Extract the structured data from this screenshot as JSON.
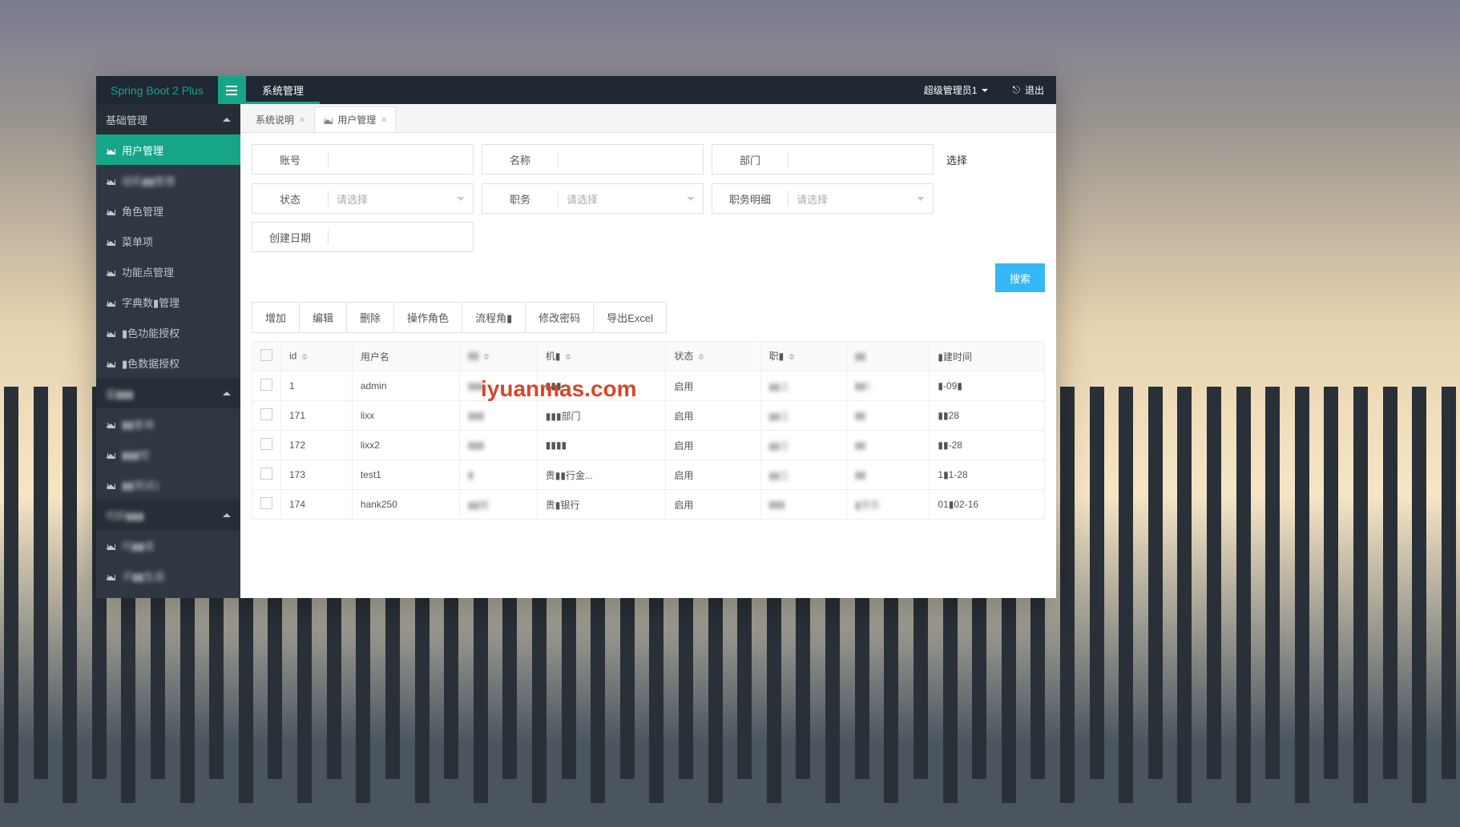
{
  "brand": "Spring Boot 2 Plus",
  "top_nav": {
    "system_mgmt": "系统管理"
  },
  "user": {
    "name": "超级管理员1",
    "logout": "退出"
  },
  "sidebar": {
    "groups": [
      {
        "label": "基础管理"
      },
      {
        "label": "监▮▮▮"
      },
      {
        "label": "代码▮▮▮"
      }
    ],
    "items": [
      "用户管理",
      "组机▮▮管理",
      "角色管理",
      "菜单项",
      "功能点管理",
      "字典数▮管理",
      "▮色功能授权",
      "▮色数据授权",
      "▮▮查询",
      "▮▮▮控",
      "▮▮测试1",
      "代▮▮成",
      "子▮▮生成"
    ]
  },
  "tabs": {
    "system_desc": "系统说明",
    "user_mgmt": "用户管理"
  },
  "filters": {
    "account": "账号",
    "name": "名称",
    "dept": "部门",
    "choose": "选择",
    "status": "状态",
    "position": "职务",
    "position_detail": "职务明细",
    "create_date": "创建日期",
    "placeholder_select": "请选择"
  },
  "buttons": {
    "search": "搜索",
    "add": "增加",
    "edit": "编辑",
    "delete": "删除",
    "op_role": "操作角色",
    "process": "流程角▮",
    "change_pwd": "修改密码",
    "export": "导出Excel"
  },
  "table": {
    "headers": {
      "id": "id",
      "username": "用户名",
      "col3": "▮▮",
      "org": "机▮",
      "status": "状态",
      "pos": "职▮",
      "col7": "▮▮",
      "create_time": "▮建时间"
    },
    "rows": [
      {
        "id": "1",
        "username": "admin",
        "c3": "▮▮▮",
        "org": "▮▮▮",
        "status": "启用",
        "pos": "▮▮立",
        "c7": "▮▮1",
        "time": "▮-09▮"
      },
      {
        "id": "171",
        "username": "lixx",
        "c3": "▮▮▮",
        "org": "▮▮▮部门",
        "status": "启用",
        "pos": "▮▮立",
        "c7": "▮▮",
        "time": "▮▮28"
      },
      {
        "id": "172",
        "username": "lixx2",
        "c3": "▮▮▮",
        "org": "▮▮▮▮",
        "status": "启用",
        "pos": "▮▮立",
        "c7": "▮▮",
        "time": "▮▮-28"
      },
      {
        "id": "173",
        "username": "test1",
        "c3": "▮",
        "org": "贵▮▮行金...",
        "status": "启用",
        "pos": "▮▮立",
        "c7": "▮▮",
        "time": "1▮1-28"
      },
      {
        "id": "174",
        "username": "hank250",
        "c3": "▮▮辑",
        "org": "贵▮银行",
        "status": "启用",
        "pos": "▮▮▮",
        "c7": "▮序员",
        "time": "01▮02-16"
      }
    ]
  },
  "watermark": "iyuanmas.com"
}
